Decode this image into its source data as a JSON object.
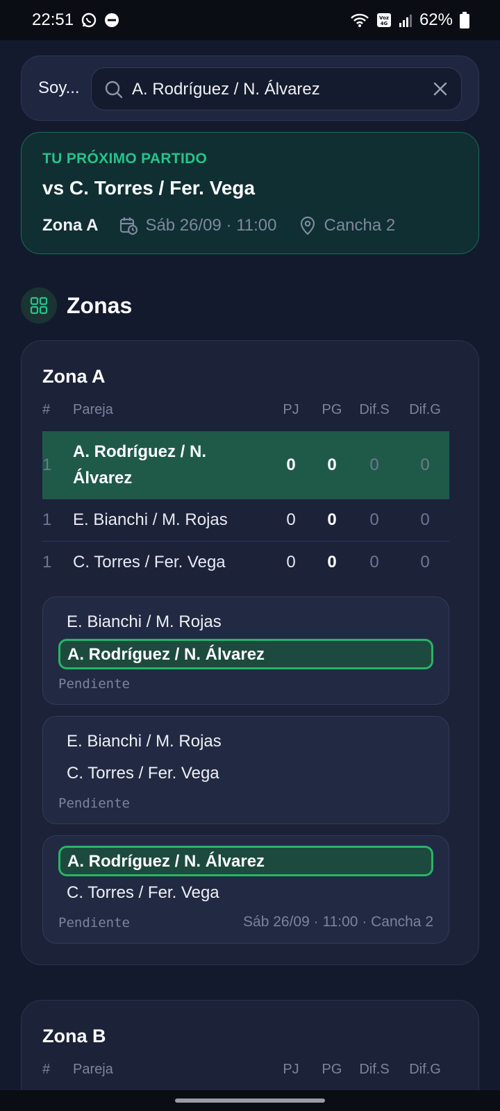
{
  "status_bar": {
    "time": "22:51",
    "battery": "62%",
    "network_label": "Voz 4G"
  },
  "search": {
    "label": "Soy...",
    "value": "A. Rodríguez / N. Álvarez"
  },
  "next_match": {
    "label": "TU PRÓXIMO PARTIDO",
    "title": "vs C. Torres / Fer. Vega",
    "zone": "Zona A",
    "datetime": "Sáb 26/09 · 11:00",
    "court": "Cancha 2"
  },
  "section": {
    "title": "Zonas"
  },
  "colors": {
    "accent": "#22c58a",
    "highlight_row": "#1f5a48",
    "mine_border": "#27b566"
  },
  "zones": [
    {
      "title": "Zona A",
      "headers": [
        "#",
        "Pareja",
        "PJ",
        "PG",
        "Dif.S",
        "Dif.G"
      ],
      "rows": [
        {
          "pos": "1",
          "pair": "A. Rodríguez / N. Álvarez",
          "pj": "0",
          "pg": "0",
          "dif_s": "0",
          "dif_g": "0"
        },
        {
          "pos": "1",
          "pair": "E. Bianchi / M. Rojas",
          "pj": "0",
          "pg": "0",
          "dif_s": "0",
          "dif_g": "0"
        },
        {
          "pos": "1",
          "pair": "C. Torres / Fer. Vega",
          "pj": "0",
          "pg": "0",
          "dif_s": "0",
          "dif_g": "0"
        }
      ],
      "matches": [
        {
          "team1": "E. Bianchi / M. Rojas",
          "team2": "A. Rodríguez / N. Álvarez",
          "status": "Pendiente",
          "when": ""
        },
        {
          "team1": "E. Bianchi / M. Rojas",
          "team2": "C. Torres / Fer. Vega",
          "status": "Pendiente",
          "when": ""
        },
        {
          "team1": "A. Rodríguez / N. Álvarez",
          "team2": "C. Torres / Fer. Vega",
          "status": "Pendiente",
          "when": "Sáb 26/09 · 11:00 · Cancha 2"
        }
      ]
    },
    {
      "title": "Zona B",
      "headers": [
        "#",
        "Pareja",
        "PJ",
        "PG",
        "Dif.S",
        "Dif.G"
      ]
    }
  ]
}
